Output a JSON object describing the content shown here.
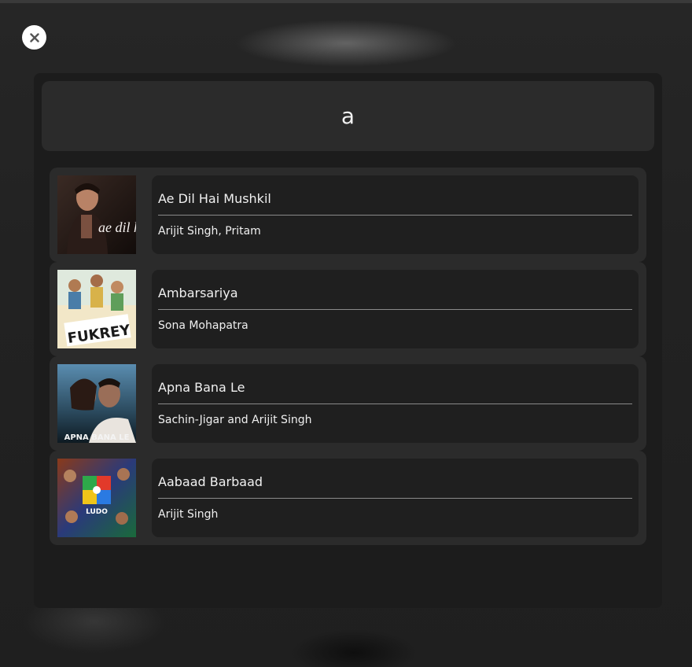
{
  "search": {
    "value": "a"
  },
  "icons": {
    "close": "close-icon"
  },
  "colors": {
    "background": "#1a1a1a",
    "modal": "#1c1c1c",
    "panel": "#2b2b2b",
    "row_info": "#1f1f1f",
    "text": "#f0f0f0"
  },
  "results": [
    {
      "title": "Ae Dil Hai Mushkil",
      "artist": "Arijit Singh, Pritam",
      "cover_text": "ae dil hai mushkil"
    },
    {
      "title": "Ambarsariya",
      "artist": "Sona Mohapatra",
      "cover_text": "FUKREY"
    },
    {
      "title": "Apna Bana Le",
      "artist": "Sachin-Jigar and Arijit Singh",
      "cover_text": "APNA BANA LE"
    },
    {
      "title": "Aabaad Barbaad",
      "artist": "Arijit Singh",
      "cover_text": "LUDO"
    }
  ]
}
